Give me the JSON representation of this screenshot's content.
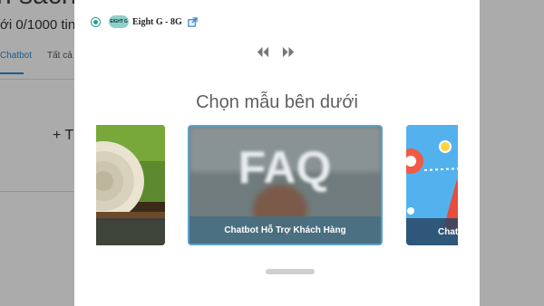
{
  "background": {
    "title": "n sách",
    "subtitle": "ới 0/1000 tin",
    "tab_active": "Chatbot",
    "tab_other": "Tất cả",
    "add_label": "+ T"
  },
  "modal": {
    "page": {
      "logo_text": "EIGHT G",
      "name": "Eight G - 8G"
    },
    "heading": "Chọn mẫu bên dưới",
    "templates": [
      {
        "caption": ""
      },
      {
        "caption": "Chatbot Hỗ Trợ Khách Hàng",
        "image_text": "FAQ"
      },
      {
        "caption": "Chat"
      }
    ]
  },
  "colors": {
    "accent": "#2a9d8f",
    "selected_border": "#5aa0c8",
    "overlay": "#a9a9a9"
  }
}
